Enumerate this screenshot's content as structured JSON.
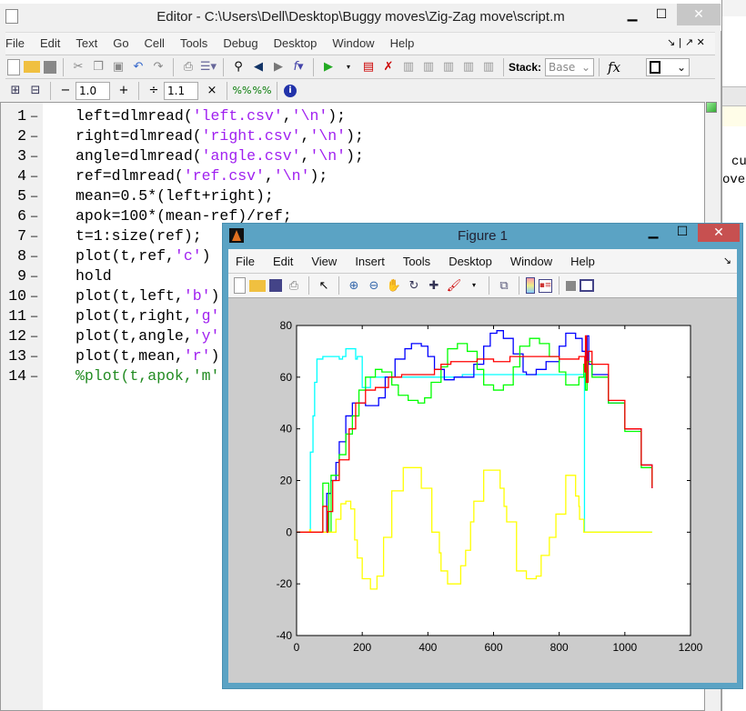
{
  "background": {
    "fragment1": "cu",
    "fragment2": "ove"
  },
  "editor": {
    "title": "Editor - C:\\Users\\Dell\\Desktop\\Buggy moves\\Zig-Zag move\\script.m",
    "menu": [
      "File",
      "Edit",
      "Text",
      "Go",
      "Cell",
      "Tools",
      "Debug",
      "Desktop",
      "Window",
      "Help"
    ],
    "toolbar": {
      "stack_label": "Stack:",
      "stack_value": "Base",
      "fx_label": "fx"
    },
    "cell_toolbar": {
      "minus": "−",
      "increment_value": "1.0",
      "plus": "+",
      "divide": "÷",
      "scale_value": "1.1",
      "times": "×"
    },
    "code_lines": [
      [
        [
          "left=dlmread(",
          ""
        ],
        [
          "'left.csv'",
          "str"
        ],
        [
          ",",
          ""
        ],
        [
          "'\\n'",
          "str"
        ],
        [
          ");",
          ""
        ]
      ],
      [
        [
          "right=dlmread(",
          ""
        ],
        [
          "'right.csv'",
          "str"
        ],
        [
          ",",
          ""
        ],
        [
          "'\\n'",
          "str"
        ],
        [
          ");",
          ""
        ]
      ],
      [
        [
          "angle=dlmread(",
          ""
        ],
        [
          "'angle.csv'",
          "str"
        ],
        [
          ",",
          ""
        ],
        [
          "'\\n'",
          "str"
        ],
        [
          ");",
          ""
        ]
      ],
      [
        [
          "ref=dlmread(",
          ""
        ],
        [
          "'ref.csv'",
          "str"
        ],
        [
          ",",
          ""
        ],
        [
          "'\\n'",
          "str"
        ],
        [
          ");",
          ""
        ]
      ],
      [
        [
          "mean=0.5*(left+right);",
          ""
        ]
      ],
      [
        [
          "apok=100*(mean-ref)/ref;",
          ""
        ]
      ],
      [
        [
          "t=1:size(ref);",
          ""
        ]
      ],
      [
        [
          "plot(t,ref,",
          ""
        ],
        [
          "'c'",
          "str"
        ],
        [
          ")",
          ""
        ]
      ],
      [
        [
          "hold",
          ""
        ]
      ],
      [
        [
          "plot(t,left,",
          ""
        ],
        [
          "'b'",
          "str"
        ],
        [
          ")",
          ""
        ]
      ],
      [
        [
          "plot(t,right,",
          ""
        ],
        [
          "'g'",
          "str"
        ],
        [
          ")",
          ""
        ]
      ],
      [
        [
          "plot(t,angle,",
          ""
        ],
        [
          "'y'",
          "str"
        ],
        [
          ")",
          ""
        ]
      ],
      [
        [
          "plot(t,mean,",
          ""
        ],
        [
          "'r'",
          "str"
        ],
        [
          ")",
          ""
        ]
      ],
      [
        [
          "%plot(t,apok,'m')",
          "cmt"
        ]
      ]
    ]
  },
  "figure": {
    "title": "Figure 1",
    "menu": [
      "File",
      "Edit",
      "View",
      "Insert",
      "Tools",
      "Desktop",
      "Window",
      "Help"
    ]
  },
  "chart_data": {
    "type": "line",
    "step": true,
    "xlim": [
      0,
      1200
    ],
    "ylim": [
      -40,
      80
    ],
    "xticks": [
      0,
      200,
      400,
      600,
      800,
      1000,
      1200
    ],
    "yticks": [
      -40,
      -20,
      0,
      20,
      40,
      60,
      80
    ],
    "grid": false,
    "series": [
      {
        "color": "#00ffff",
        "points": [
          [
            0,
            0
          ],
          [
            42,
            0
          ],
          [
            42,
            31
          ],
          [
            50,
            31
          ],
          [
            50,
            45
          ],
          [
            55,
            58
          ],
          [
            62,
            67
          ],
          [
            80,
            68
          ],
          [
            130,
            67
          ],
          [
            140,
            68
          ],
          [
            150,
            71
          ],
          [
            178,
            71
          ],
          [
            180,
            67
          ],
          [
            185,
            68
          ],
          [
            200,
            68
          ],
          [
            200,
            56
          ],
          [
            225,
            56
          ],
          [
            225,
            60
          ],
          [
            500,
            60
          ],
          [
            505,
            61
          ],
          [
            875,
            61
          ],
          [
            877,
            0
          ],
          [
            1083,
            0
          ]
        ]
      },
      {
        "color": "#0000ff",
        "points": [
          [
            0,
            0
          ],
          [
            90,
            0
          ],
          [
            92,
            15
          ],
          [
            102,
            15
          ],
          [
            105,
            20
          ],
          [
            120,
            27
          ],
          [
            130,
            35
          ],
          [
            150,
            45
          ],
          [
            170,
            50
          ],
          [
            200,
            50
          ],
          [
            210,
            49
          ],
          [
            230,
            49
          ],
          [
            250,
            52
          ],
          [
            270,
            60
          ],
          [
            300,
            67
          ],
          [
            330,
            71
          ],
          [
            350,
            73
          ],
          [
            380,
            72
          ],
          [
            400,
            68
          ],
          [
            420,
            63
          ],
          [
            450,
            59
          ],
          [
            480,
            60
          ],
          [
            520,
            60
          ],
          [
            540,
            65
          ],
          [
            570,
            72
          ],
          [
            590,
            77
          ],
          [
            610,
            78
          ],
          [
            630,
            75
          ],
          [
            660,
            69
          ],
          [
            690,
            62
          ],
          [
            700,
            61
          ],
          [
            730,
            63
          ],
          [
            760,
            66
          ],
          [
            800,
            72
          ],
          [
            820,
            77
          ],
          [
            850,
            75
          ],
          [
            870,
            70
          ],
          [
            880,
            62
          ],
          [
            885,
            76
          ],
          [
            890,
            65
          ],
          [
            900,
            61
          ],
          [
            950,
            50
          ],
          [
            1000,
            40
          ],
          [
            1050,
            26
          ],
          [
            1083,
            17
          ]
        ]
      },
      {
        "color": "#00ff00",
        "points": [
          [
            0,
            0
          ],
          [
            80,
            0
          ],
          [
            80,
            19
          ],
          [
            95,
            19
          ],
          [
            98,
            0
          ],
          [
            103,
            0
          ],
          [
            105,
            22
          ],
          [
            130,
            30
          ],
          [
            150,
            38
          ],
          [
            170,
            45
          ],
          [
            190,
            55
          ],
          [
            210,
            60
          ],
          [
            240,
            63
          ],
          [
            260,
            62
          ],
          [
            290,
            57
          ],
          [
            310,
            53
          ],
          [
            340,
            51
          ],
          [
            370,
            50
          ],
          [
            390,
            52
          ],
          [
            410,
            58
          ],
          [
            440,
            64
          ],
          [
            460,
            71
          ],
          [
            490,
            73
          ],
          [
            520,
            70
          ],
          [
            550,
            63
          ],
          [
            570,
            57
          ],
          [
            600,
            55
          ],
          [
            630,
            57
          ],
          [
            660,
            64
          ],
          [
            680,
            72
          ],
          [
            710,
            75
          ],
          [
            740,
            73
          ],
          [
            770,
            68
          ],
          [
            800,
            62
          ],
          [
            820,
            57
          ],
          [
            840,
            57
          ],
          [
            860,
            60
          ],
          [
            875,
            65
          ],
          [
            880,
            55
          ],
          [
            885,
            66
          ],
          [
            900,
            60
          ],
          [
            950,
            50
          ],
          [
            1000,
            39
          ],
          [
            1050,
            25
          ],
          [
            1083,
            18
          ]
        ]
      },
      {
        "color": "#ffff00",
        "points": [
          [
            0,
            0
          ],
          [
            40,
            0
          ],
          [
            40,
            1
          ],
          [
            43,
            0
          ],
          [
            120,
            0
          ],
          [
            120,
            5
          ],
          [
            135,
            5
          ],
          [
            135,
            11
          ],
          [
            150,
            12
          ],
          [
            160,
            12
          ],
          [
            165,
            9
          ],
          [
            175,
            9
          ],
          [
            177,
            -3
          ],
          [
            185,
            -10
          ],
          [
            200,
            -10
          ],
          [
            200,
            -18
          ],
          [
            225,
            -18
          ],
          [
            225,
            -22
          ],
          [
            245,
            -22
          ],
          [
            245,
            -17
          ],
          [
            265,
            -17
          ],
          [
            265,
            -2
          ],
          [
            290,
            -2
          ],
          [
            290,
            16
          ],
          [
            325,
            16
          ],
          [
            325,
            25
          ],
          [
            380,
            25
          ],
          [
            380,
            17
          ],
          [
            410,
            17
          ],
          [
            412,
            0
          ],
          [
            430,
            0
          ],
          [
            435,
            -8
          ],
          [
            440,
            -15
          ],
          [
            460,
            -15
          ],
          [
            460,
            -20
          ],
          [
            490,
            -20
          ],
          [
            500,
            -13
          ],
          [
            515,
            -13
          ],
          [
            515,
            -7
          ],
          [
            530,
            -7
          ],
          [
            530,
            4
          ],
          [
            540,
            4
          ],
          [
            540,
            12
          ],
          [
            570,
            12
          ],
          [
            570,
            24
          ],
          [
            620,
            24
          ],
          [
            620,
            17
          ],
          [
            630,
            17
          ],
          [
            632,
            10
          ],
          [
            640,
            10
          ],
          [
            640,
            4
          ],
          [
            670,
            4
          ],
          [
            670,
            -15
          ],
          [
            690,
            -15
          ],
          [
            700,
            -18
          ],
          [
            730,
            -18
          ],
          [
            730,
            -17
          ],
          [
            745,
            -17
          ],
          [
            745,
            -9
          ],
          [
            770,
            -9
          ],
          [
            770,
            -2
          ],
          [
            790,
            -2
          ],
          [
            790,
            7
          ],
          [
            820,
            7
          ],
          [
            820,
            22
          ],
          [
            845,
            22
          ],
          [
            850,
            14
          ],
          [
            860,
            10
          ],
          [
            862,
            5
          ],
          [
            873,
            5
          ],
          [
            875,
            0
          ],
          [
            1083,
            0
          ]
        ]
      },
      {
        "color": "#ff0000",
        "points": [
          [
            0,
            0
          ],
          [
            80,
            0
          ],
          [
            80,
            10
          ],
          [
            92,
            10
          ],
          [
            93,
            0
          ],
          [
            95,
            0
          ],
          [
            95,
            8
          ],
          [
            105,
            8
          ],
          [
            110,
            20
          ],
          [
            130,
            28
          ],
          [
            160,
            40
          ],
          [
            180,
            50
          ],
          [
            210,
            55
          ],
          [
            240,
            56
          ],
          [
            280,
            60
          ],
          [
            320,
            61
          ],
          [
            400,
            61
          ],
          [
            420,
            63
          ],
          [
            440,
            65
          ],
          [
            470,
            66
          ],
          [
            550,
            67
          ],
          [
            600,
            66
          ],
          [
            650,
            68
          ],
          [
            750,
            68
          ],
          [
            800,
            67
          ],
          [
            860,
            68
          ],
          [
            878,
            62
          ],
          [
            880,
            76
          ],
          [
            883,
            58
          ],
          [
            888,
            70
          ],
          [
            900,
            65
          ],
          [
            950,
            51
          ],
          [
            1000,
            40
          ],
          [
            1050,
            26
          ],
          [
            1083,
            17
          ]
        ]
      }
    ]
  }
}
